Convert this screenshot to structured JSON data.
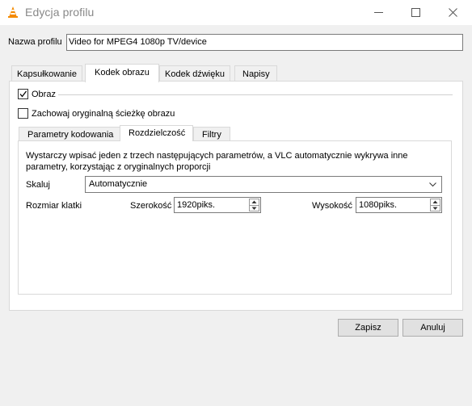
{
  "window": {
    "title": "Edycja profilu",
    "icon": "vlc-cone-icon",
    "controls": [
      "minimize-icon",
      "maximize-icon",
      "close-icon"
    ]
  },
  "profile": {
    "label": "Nazwa profilu",
    "value": "Video for MPEG4 1080p TV/device"
  },
  "tabs": [
    {
      "label": "Kapsułkowanie"
    },
    {
      "label": "Kodek obrazu",
      "active": true
    },
    {
      "label": "Kodek dźwięku"
    },
    {
      "label": "Napisy"
    }
  ],
  "video": {
    "enable_label": "Obraz",
    "enable_checked": true,
    "keep_label": "Zachowaj oryginalną ścieżkę obrazu",
    "keep_checked": false
  },
  "subtabs": [
    {
      "label": "Parametry kodowania"
    },
    {
      "label": "Rozdzielczość",
      "active": true
    },
    {
      "label": "Filtry"
    }
  ],
  "resolution": {
    "info": "Wystarczy wpisać jeden z trzech następujących parametrów, a VLC automatycznie wykrywa inne parametry, korzystając z oryginalnych proporcji",
    "scale_label": "Skaluj",
    "scale_value": "Automatycznie",
    "frame_label": "Rozmiar klatki",
    "width_label": "Szerokość",
    "width_value": "1920piks.",
    "height_label": "Wysokość",
    "height_value": "1080piks."
  },
  "buttons": {
    "save": "Zapisz",
    "cancel": "Anuluj"
  },
  "colors": {
    "background": "#f0f0f0",
    "vlc_orange": "#f48a00"
  }
}
